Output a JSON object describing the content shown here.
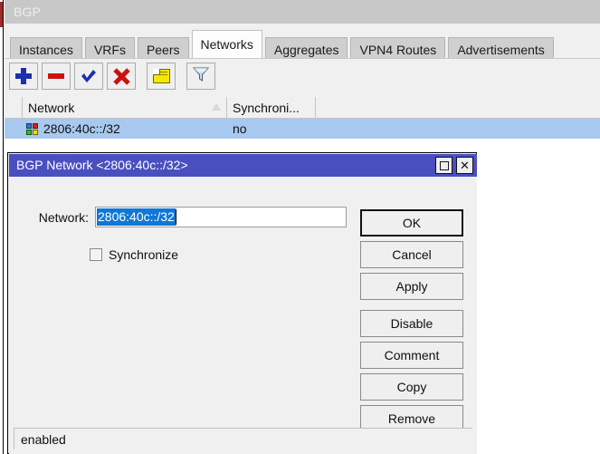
{
  "window": {
    "title": "BGP"
  },
  "tabs": [
    {
      "label": "Instances",
      "active": false
    },
    {
      "label": "VRFs",
      "active": false
    },
    {
      "label": "Peers",
      "active": false
    },
    {
      "label": "Networks",
      "active": true
    },
    {
      "label": "Aggregates",
      "active": false
    },
    {
      "label": "VPN4 Routes",
      "active": false
    },
    {
      "label": "Advertisements",
      "active": false
    }
  ],
  "toolbar": {
    "buttons": [
      {
        "name": "add-button",
        "icon": "plus-icon"
      },
      {
        "name": "remove-button",
        "icon": "minus-icon"
      },
      {
        "name": "enable-button",
        "icon": "check-icon"
      },
      {
        "name": "disable-button",
        "icon": "x-icon"
      },
      {
        "name": "comment-button",
        "icon": "note-icon"
      },
      {
        "name": "filter-button",
        "icon": "filter-icon"
      }
    ]
  },
  "table": {
    "columns": [
      {
        "label": "Network",
        "sorted": true
      },
      {
        "label": "Synchroni...",
        "sorted": false
      }
    ],
    "rows": [
      {
        "network": "2806:40c::/32",
        "synchronize": "no",
        "selected": true,
        "icon": "quad-color-icon"
      }
    ]
  },
  "dialog": {
    "title": "BGP Network <2806:40c::/32>",
    "titlebar_buttons": [
      {
        "name": "maximize-button",
        "icon": "maximize-icon"
      },
      {
        "name": "close-button",
        "icon": "close-icon"
      }
    ],
    "fields": {
      "network_label": "Network:",
      "network_value": "2806:40c::/32",
      "network_placeholder": "",
      "synchronize_label": "Synchronize",
      "synchronize_checked": false
    },
    "buttons": [
      {
        "label": "OK",
        "focused": true,
        "gap": false
      },
      {
        "label": "Cancel",
        "focused": false,
        "gap": false
      },
      {
        "label": "Apply",
        "focused": false,
        "gap": false
      },
      {
        "label": "Disable",
        "focused": false,
        "gap": true
      },
      {
        "label": "Comment",
        "focused": false,
        "gap": false
      },
      {
        "label": "Copy",
        "focused": false,
        "gap": false
      },
      {
        "label": "Remove",
        "focused": false,
        "gap": false
      }
    ],
    "status": "enabled"
  },
  "colors": {
    "dialog_title_bg": "#4a4fc0",
    "row_selected_bg": "#a8c9ef",
    "text_selection_bg": "#1078d4",
    "window_chrome": "#f0f0f0"
  }
}
